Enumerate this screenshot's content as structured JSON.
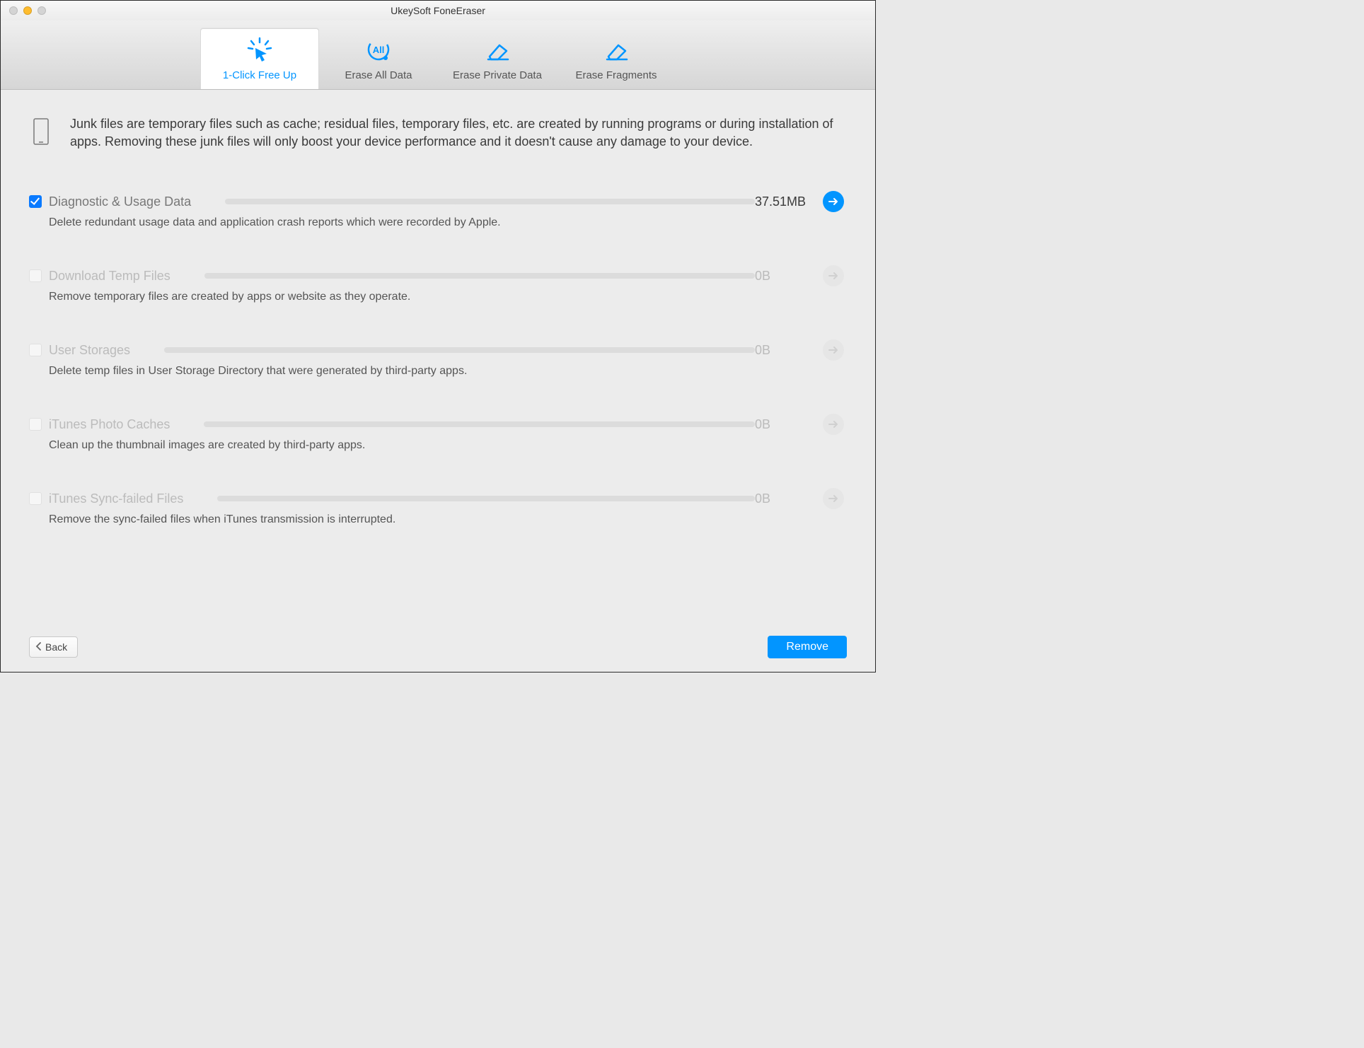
{
  "window": {
    "title": "UkeySoft FoneEraser"
  },
  "tabs": {
    "freeup": "1-Click Free Up",
    "erase_all": "Erase All Data",
    "erase_private": "Erase Private Data",
    "erase_fragments": "Erase Fragments"
  },
  "intro": "Junk files are temporary files such as cache; residual files, temporary files, etc. are created by running programs or during installation of apps. Removing these junk files will only boost your device performance and it doesn't cause any damage to your device.",
  "items": [
    {
      "title": "Diagnostic & Usage Data",
      "desc": "Delete redundant usage data and application crash reports which were recorded by Apple.",
      "size": "37.51MB",
      "checked": true,
      "enabled": true
    },
    {
      "title": "Download Temp Files",
      "desc": "Remove temporary files are created by apps or website as they operate.",
      "size": "0B",
      "checked": false,
      "enabled": false
    },
    {
      "title": "User Storages",
      "desc": "Delete temp files in User Storage Directory that were generated by third-party apps.",
      "size": "0B",
      "checked": false,
      "enabled": false
    },
    {
      "title": "iTunes Photo Caches",
      "desc": "Clean up the thumbnail images are created by third-party apps.",
      "size": "0B",
      "checked": false,
      "enabled": false
    },
    {
      "title": "iTunes Sync-failed Files",
      "desc": "Remove the sync-failed files when iTunes transmission is interrupted.",
      "size": "0B",
      "checked": false,
      "enabled": false
    }
  ],
  "footer": {
    "back": "Back",
    "remove": "Remove"
  }
}
